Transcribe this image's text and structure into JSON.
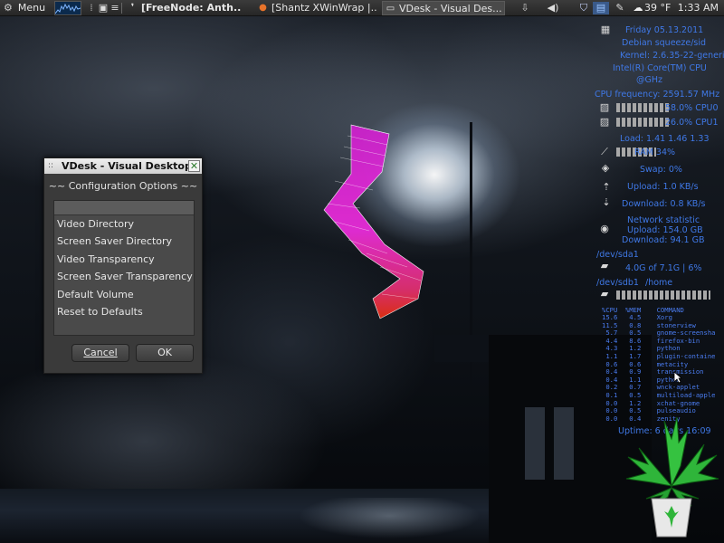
{
  "panel": {
    "menu_label": "Menu",
    "menu_icon": "gear-icon",
    "tasks": [
      {
        "label": "[FreeNode: Anth...",
        "icon": "chat-icon"
      },
      {
        "label": "[Shantz XWinWrap |...",
        "icon": "firefox-icon"
      },
      {
        "label": "VDesk - Visual Des...",
        "icon": "window-icon"
      }
    ],
    "weather": "39 °F",
    "clock": "1:33 AM"
  },
  "dialog": {
    "title": "VDesk - Visual Desktop",
    "heading": "~~ Configuration Options ~~",
    "options": [
      "Video Directory",
      "Screen Saver Directory",
      "Video Transparency",
      "Screen Saver Transparency",
      "Default Volume",
      "Reset to Defaults"
    ],
    "cancel_label": "Cancel",
    "ok_label": "OK"
  },
  "conky": {
    "date": "Friday 05.13.2011",
    "os": "Debian squeeze/sid",
    "kernel": "Kernel: 2.6.35-22-generic",
    "cpu_model": "Intel(R) Core(TM) CPU",
    "cpu_speed": "@GHz",
    "frequency": "CPU frequency: 2591.57 MHz",
    "cpu0": "58.0% CPU0",
    "cpu1": "26.0% CPU1",
    "load": "Load: 1.41 1.46 1.33",
    "ram": "RAM 34%",
    "swap": "Swap: 0%",
    "upload": "Upload: 1.0 KB/s",
    "download": "Download: 0.8 KB/s",
    "net_title": "Network statistic",
    "net_upload": "Upload: 154.0 GB",
    "net_download": "Download: 94.1 GB",
    "sda1": "/dev/sda1",
    "sda1_usage": "4.0G of 7.1G | 6%",
    "sdb1": "/dev/sdb1",
    "sdb1_mount": "/home",
    "proc_header": [
      "%CPU",
      "%MEM",
      "COMMAND"
    ],
    "processes": [
      [
        "15.6",
        "4.5",
        "Xorg"
      ],
      [
        "11.5",
        "0.8",
        "stonerview"
      ],
      [
        "5.7",
        "0.5",
        "gnome-screensha"
      ],
      [
        "4.4",
        "8.6",
        "firefox-bin"
      ],
      [
        "4.3",
        "1.2",
        "python"
      ],
      [
        "1.1",
        "1.7",
        "plugin-containe"
      ],
      [
        "0.6",
        "0.6",
        "metacity"
      ],
      [
        "0.4",
        "0.9",
        "transmission"
      ],
      [
        "0.4",
        "1.1",
        "python"
      ],
      [
        "0.2",
        "0.7",
        "wnck-applet"
      ],
      [
        "0.1",
        "0.5",
        "multiload-apple"
      ],
      [
        "0.0",
        "1.2",
        "xchat-gnome"
      ],
      [
        "0.0",
        "0.5",
        "pulseaudio"
      ],
      [
        "0.0",
        "0.4",
        "zenity"
      ]
    ],
    "uptime": "Uptime: 6 days 16:09"
  }
}
